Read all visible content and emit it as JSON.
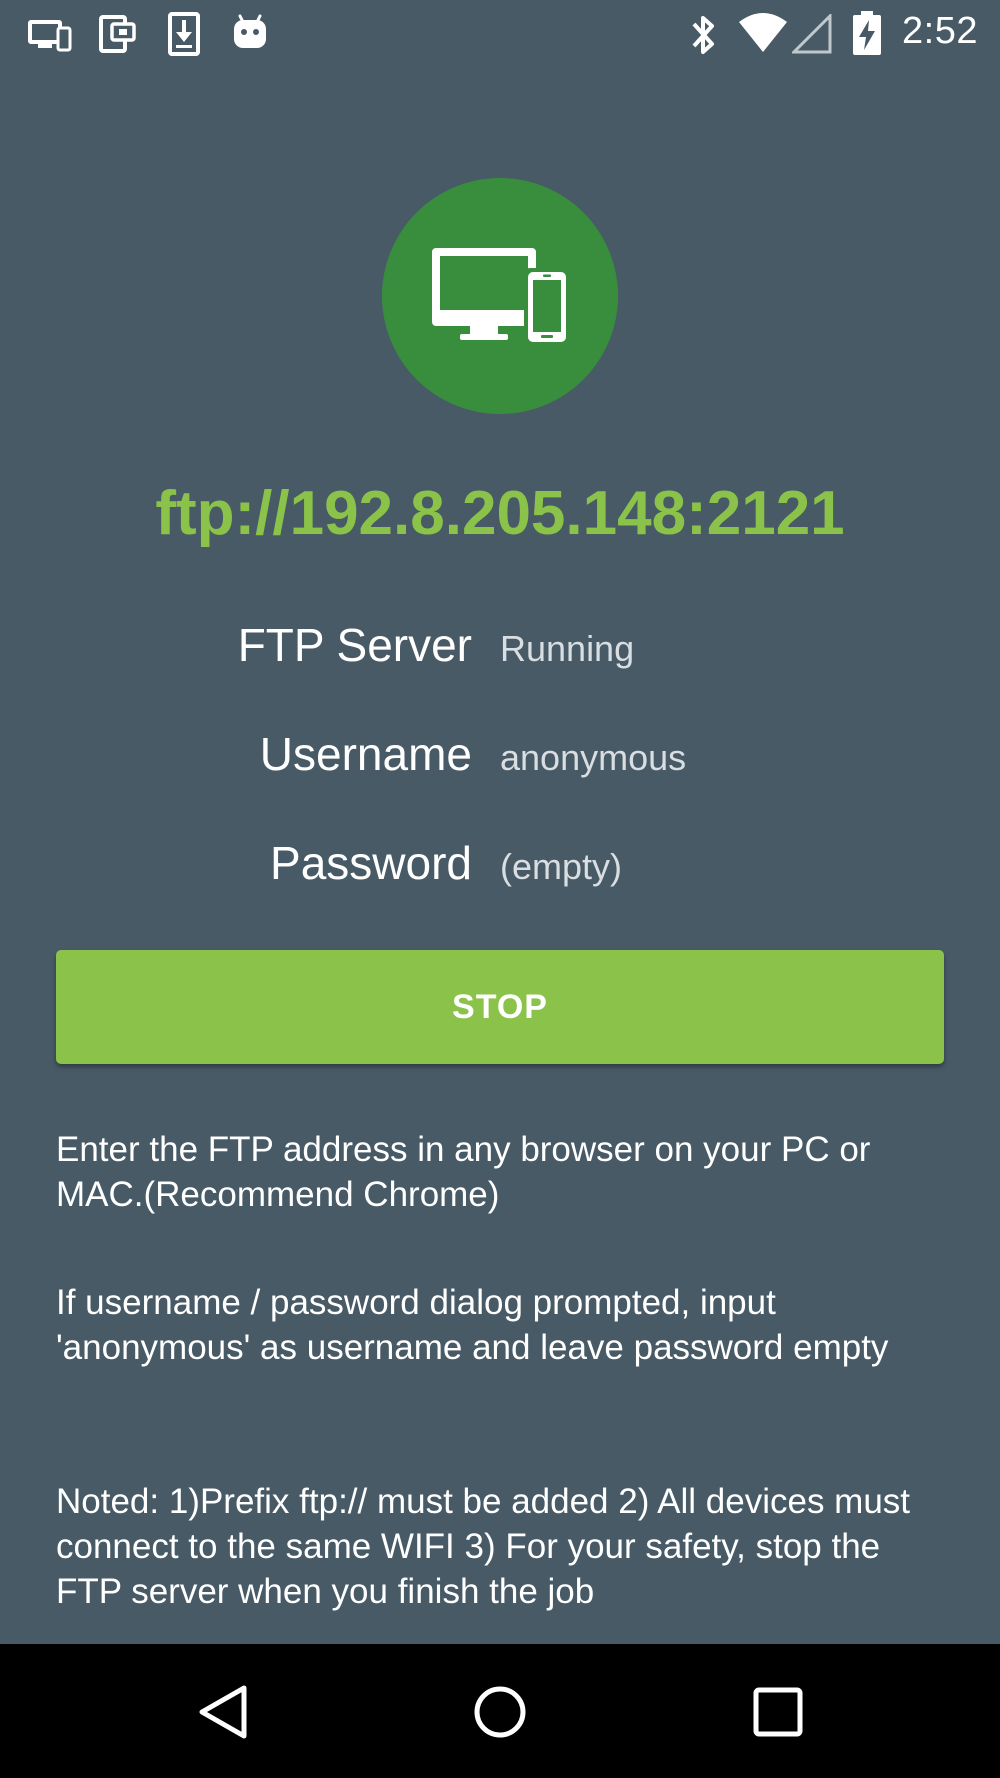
{
  "status_bar": {
    "time": "2:52",
    "left_icons": [
      "devices-icon",
      "screen-share-icon",
      "download-icon",
      "android-icon"
    ],
    "right_icons": [
      "bluetooth-icon",
      "wifi-icon",
      "cell-signal-icon",
      "battery-charging-icon"
    ]
  },
  "hero": {
    "icon": "devices-icon",
    "color": "#388e3c"
  },
  "ftp_address": "ftp://192.8.205.148:2121",
  "info": {
    "server": {
      "label": "FTP Server",
      "value": "Running"
    },
    "username": {
      "label": "Username",
      "value": "anonymous"
    },
    "password": {
      "label": "Password",
      "value": "(empty)"
    }
  },
  "stop_button": {
    "label": "STOP",
    "color": "#8bc34a"
  },
  "instructions": [
    "Enter the FTP address in any browser on your PC or MAC.(Recommend Chrome)",
    "If username / password dialog prompted, input 'anonymous' as username and leave password empty",
    "Noted: 1)Prefix ftp:// must be added 2) All devices must connect to the same WIFI 3) For your safety, stop the FTP server when you finish the job"
  ],
  "nav_bar": {
    "buttons": [
      "back-icon",
      "home-icon",
      "recents-icon"
    ]
  },
  "colors": {
    "background": "#475a66",
    "accent": "#8bc34a",
    "hero": "#388e3c",
    "nav_bar": "#000000"
  }
}
